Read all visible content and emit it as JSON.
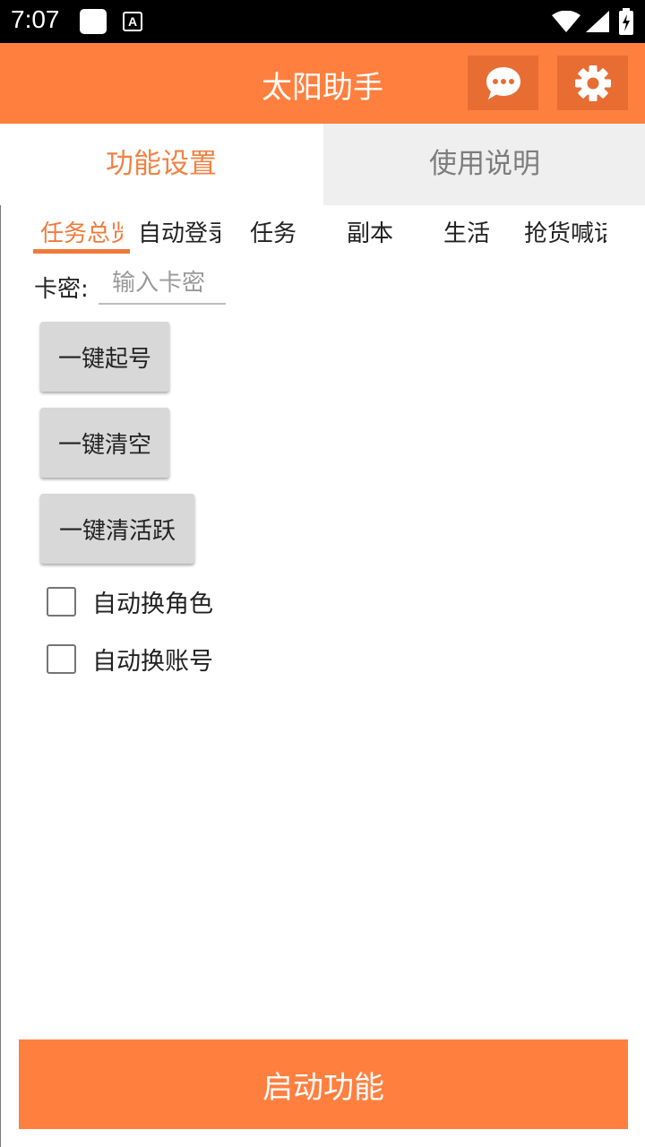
{
  "status_bar": {
    "time": "7:07",
    "notif_a": "A"
  },
  "app_bar": {
    "title": "太阳助手",
    "message_icon": "chat-bubble-icon",
    "settings_icon": "gear-icon",
    "accent_color": "#FF7F3F"
  },
  "main_tabs": [
    {
      "label": "功能设置",
      "active": true
    },
    {
      "label": "使用说明",
      "active": false
    }
  ],
  "sub_tabs": [
    {
      "label": "任务总览",
      "active": true
    },
    {
      "label": "自动登录"
    },
    {
      "label": "任务"
    },
    {
      "label": "副本"
    },
    {
      "label": "生活"
    },
    {
      "label": "抢货喊话"
    }
  ],
  "card_key": {
    "label": "卡密:",
    "placeholder": "输入卡密",
    "value": ""
  },
  "buttons": [
    {
      "label": "一键起号"
    },
    {
      "label": "一键清空"
    },
    {
      "label": "一键清活跃"
    }
  ],
  "checkboxes": [
    {
      "label": "自动换角色",
      "checked": false
    },
    {
      "label": "自动换账号",
      "checked": false
    }
  ],
  "start_button": {
    "label": "启动功能"
  }
}
